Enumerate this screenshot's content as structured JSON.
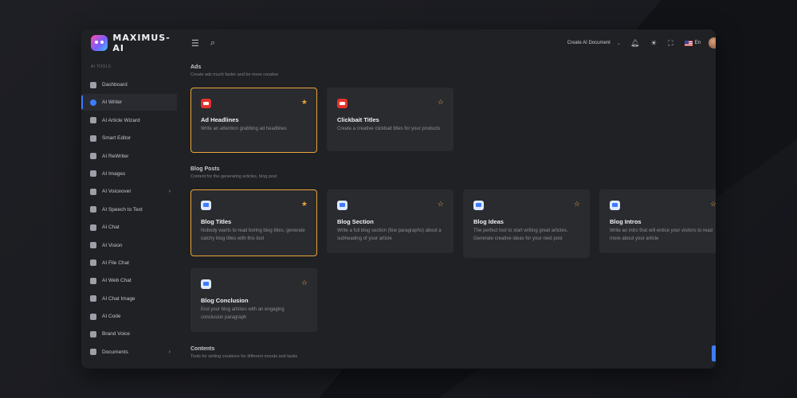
{
  "app": {
    "name": "MAXIMUS-AI"
  },
  "header": {
    "create_document": "Create AI Document",
    "language": "En"
  },
  "sidebar": {
    "section_label": "AI TOOLS",
    "items": [
      {
        "label": "Dashboard",
        "icon": "grid-icon"
      },
      {
        "label": "AI Writer",
        "icon": "writer-icon",
        "active": true
      },
      {
        "label": "AI Article Wizard",
        "icon": "wand-icon"
      },
      {
        "label": "Smart Editor",
        "icon": "feather-icon"
      },
      {
        "label": "AI ReWriter",
        "icon": "pen-icon"
      },
      {
        "label": "AI Images",
        "icon": "image-icon"
      },
      {
        "label": "AI Voiceover",
        "icon": "voice-icon",
        "has_arrow": true
      },
      {
        "label": "AI Speech to Text",
        "icon": "speech-icon"
      },
      {
        "label": "AI Chat",
        "icon": "chat-icon"
      },
      {
        "label": "AI Vision",
        "icon": "eye-icon"
      },
      {
        "label": "AI File Chat",
        "icon": "folder-icon"
      },
      {
        "label": "AI Web Chat",
        "icon": "globe-icon"
      },
      {
        "label": "AI Chat Image",
        "icon": "chat-image-icon"
      },
      {
        "label": "AI Code",
        "icon": "code-icon"
      },
      {
        "label": "Brand Voice",
        "icon": "megaphone-icon"
      },
      {
        "label": "Documents",
        "icon": "documents-icon",
        "has_arrow": true
      }
    ]
  },
  "sections": {
    "ads": {
      "title": "Ads",
      "subtitle": "Create ads much faster and be more creative"
    },
    "blog": {
      "title": "Blog Posts",
      "subtitle": "Content for the generating articles, blog post"
    },
    "contents": {
      "title": "Contents",
      "subtitle": "Tools for writing creatives for different moods and tasks"
    }
  },
  "cards": {
    "ad_headlines": {
      "title": "Ad Headlines",
      "desc": "Write an attention grabbing ad headlines"
    },
    "clickbait": {
      "title": "Clickbait Titles",
      "desc": "Create a creative clickbait titles for your products"
    },
    "blog_titles": {
      "title": "Blog Titles",
      "desc": "Nobody wants to read boring blog titles, generate catchy blog titles with this tool"
    },
    "blog_section": {
      "title": "Blog Section",
      "desc": "Write a full blog section (few paragraphs) about a subheading of your article"
    },
    "blog_ideas": {
      "title": "Blog Ideas",
      "desc": "The perfect tool to start writing great articles. Generate creative ideas for your next post"
    },
    "blog_intros": {
      "title": "Blog Intros",
      "desc": "Write an intro that will entice your visitors to read more about your article"
    },
    "blog_conclusion": {
      "title": "Blog Conclusion",
      "desc": "End your blog articles with an engaging conclusion paragraph"
    }
  },
  "colors": {
    "accent": "#3d7cff",
    "selected_border": "#e9a53a",
    "star": "#e9a53a",
    "ad_icon": "#e5322d"
  }
}
